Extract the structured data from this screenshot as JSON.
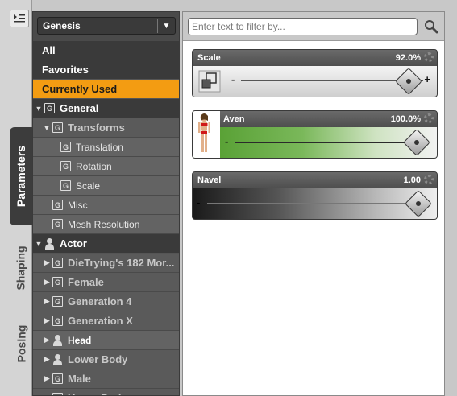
{
  "tabs": {
    "parameters": "Parameters",
    "shaping": "Shaping",
    "posing": "Posing"
  },
  "tree": {
    "figure_select": "Genesis",
    "categories": [
      {
        "label": "All",
        "selected": false
      },
      {
        "label": "Favorites",
        "selected": false
      },
      {
        "label": "Currently Used",
        "selected": true
      }
    ],
    "items": [
      {
        "label": "General",
        "icon": "group-icon",
        "expander": "open",
        "style": "cat",
        "indent": 0
      },
      {
        "label": "Transforms",
        "icon": "group-icon",
        "expander": "open",
        "style": "grp",
        "indent": 1
      },
      {
        "label": "Translation",
        "icon": "group-icon",
        "expander": "none",
        "style": "leaf",
        "indent": 2
      },
      {
        "label": "Rotation",
        "icon": "group-icon",
        "expander": "none",
        "style": "leaf",
        "indent": 2
      },
      {
        "label": "Scale",
        "icon": "group-icon",
        "expander": "none",
        "style": "leaf",
        "indent": 2
      },
      {
        "label": "Misc",
        "icon": "group-icon",
        "expander": "none",
        "style": "leaf",
        "indent": 1
      },
      {
        "label": "Mesh Resolution",
        "icon": "group-icon",
        "expander": "none",
        "style": "leaf",
        "indent": 1
      },
      {
        "label": "Actor",
        "icon": "person-icon",
        "expander": "open",
        "style": "cat",
        "indent": 0
      },
      {
        "label": "DieTrying's 182 Mor...",
        "icon": "group-icon",
        "expander": "closed",
        "style": "grp",
        "indent": 1
      },
      {
        "label": "Female",
        "icon": "group-icon",
        "expander": "closed",
        "style": "grp",
        "indent": 1
      },
      {
        "label": "Generation 4",
        "icon": "group-icon",
        "expander": "closed",
        "style": "grp",
        "indent": 1
      },
      {
        "label": "Generation X",
        "icon": "group-icon",
        "expander": "closed",
        "style": "grp",
        "indent": 1
      },
      {
        "label": "Head",
        "icon": "person-icon",
        "expander": "closed",
        "style": "leafbold",
        "indent": 1
      },
      {
        "label": "Lower Body",
        "icon": "person-icon",
        "expander": "closed",
        "style": "grp",
        "indent": 1
      },
      {
        "label": "Male",
        "icon": "group-icon",
        "expander": "closed",
        "style": "grp",
        "indent": 1
      },
      {
        "label": "Upper Body",
        "icon": "group-icon",
        "expander": "closed",
        "style": "grp",
        "indent": 1
      }
    ]
  },
  "filter": {
    "placeholder": "Enter text to filter by..."
  },
  "sliders": [
    {
      "name": "Scale",
      "value": "92.0%",
      "level": 0.92,
      "style": "scale"
    },
    {
      "name": "Aven",
      "value": "100.0%",
      "level": 1.0,
      "style": "morph"
    },
    {
      "name": "Navel",
      "value": "1.00",
      "level": 1.0,
      "style": "navel"
    }
  ],
  "colors": {
    "accent": "#f39c12",
    "morph_green": "#5aa832"
  }
}
